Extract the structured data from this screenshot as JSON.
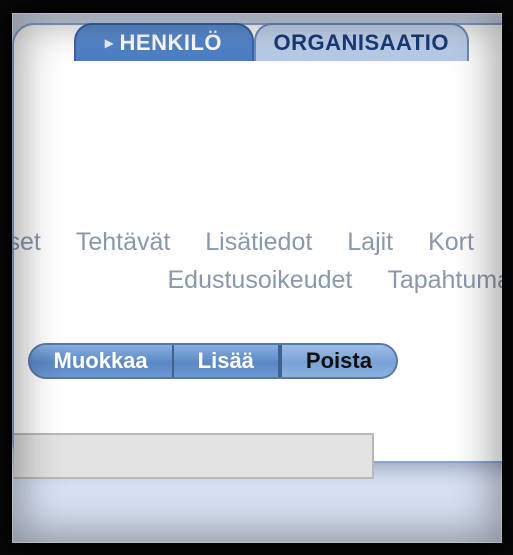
{
  "tabs": {
    "active": "HENKILÖ",
    "inactive": "ORGANISAATIO"
  },
  "subnav": {
    "row1": [
      "set",
      "Tehtävät",
      "Lisätiedot",
      "Lajit",
      "Kort"
    ],
    "row2": [
      "Edustusoikeudet",
      "Tapahtuma"
    ]
  },
  "actions": {
    "edit": "Muokkaa",
    "add": "Lisää",
    "delete": "Poista"
  },
  "input": {
    "value": ""
  }
}
